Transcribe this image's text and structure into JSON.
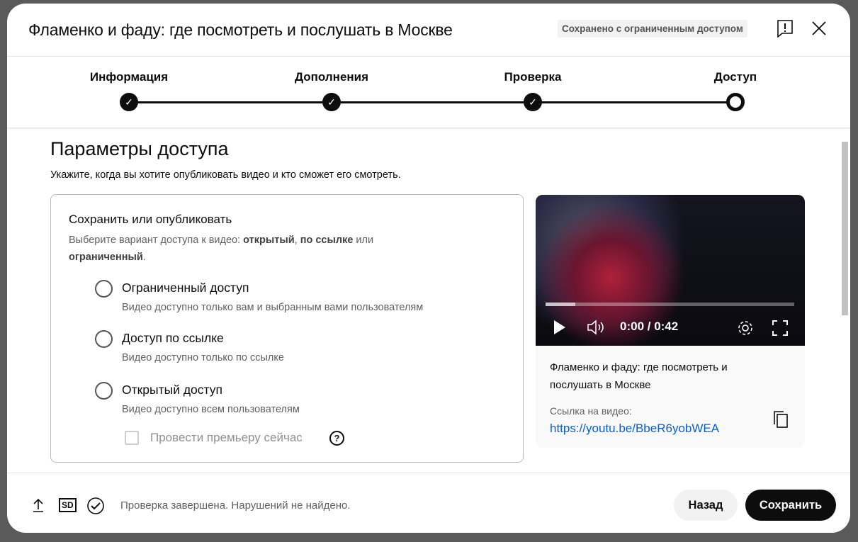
{
  "header": {
    "title": "Фламенко и фаду: где посмотреть и послушать в Москве",
    "status_badge": "Сохранено с ограниченным доступом"
  },
  "steps": [
    {
      "label": "Информация",
      "state": "done"
    },
    {
      "label": "Дополнения",
      "state": "done"
    },
    {
      "label": "Проверка",
      "state": "done"
    },
    {
      "label": "Доступ",
      "state": "current"
    }
  ],
  "main": {
    "heading": "Параметры доступа",
    "subtitle": "Укажите, когда вы хотите опубликовать видео и кто сможет его смотреть.",
    "card": {
      "title": "Сохранить или опубликовать",
      "desc_prefix": "Выберите вариант доступа к видео: ",
      "desc_b1": "открытый",
      "desc_sep": ", ",
      "desc_b2": "по ссылке",
      "desc_mid": " или ",
      "desc_b3": "ограниченный",
      "desc_end": ".",
      "options": [
        {
          "label": "Ограниченный доступ",
          "desc": "Видео доступно только вам и выбранным вами пользователям",
          "selected": false
        },
        {
          "label": "Доступ по ссылке",
          "desc": "Видео доступно только по ссылке",
          "selected": false
        },
        {
          "label": "Открытый доступ",
          "desc": "Видео доступно всем пользователям",
          "selected": false
        }
      ],
      "premiere_label": "Провести премьеру сейчас",
      "premiere_checked": false,
      "help": "?"
    }
  },
  "preview": {
    "time": "0:00 / 0:42",
    "progress": 0.12,
    "title": "Фламенко и фаду: где посмотреть и послушать в Москве",
    "link_label": "Ссылка на видео:",
    "link": "https://youtu.be/BbeR6yobWEA"
  },
  "footer": {
    "sd": "SD",
    "status": "Проверка завершена. Нарушений не найдено.",
    "back": "Назад",
    "save": "Сохранить"
  }
}
